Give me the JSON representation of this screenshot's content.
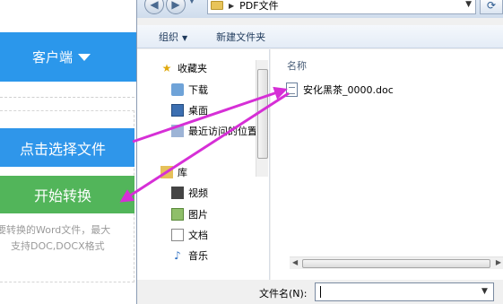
{
  "webpage": {
    "client_label": "客户端",
    "choose_file_button": "点击选择文件",
    "start_convert_button": "开始转换",
    "hint_line1": "要转换的Word文件，最大",
    "hint_line2": "支持DOC,DOCX格式"
  },
  "dialog": {
    "breadcrumb_folder": "PDF文件",
    "toolbar": {
      "organize": "组织",
      "new_folder": "新建文件夹"
    },
    "nav_items": [
      {
        "label": "收藏夹",
        "icon": "star-icon"
      },
      {
        "label": "下载",
        "icon": "download-folder-icon"
      },
      {
        "label": "桌面",
        "icon": "desktop-icon"
      },
      {
        "label": "最近访问的位置",
        "icon": "recent-places-icon"
      },
      {
        "label": "库",
        "icon": "library-icon"
      },
      {
        "label": "视频",
        "icon": "video-icon"
      },
      {
        "label": "图片",
        "icon": "picture-icon"
      },
      {
        "label": "文档",
        "icon": "document-icon"
      },
      {
        "label": "音乐",
        "icon": "music-icon"
      }
    ],
    "column_header": "名称",
    "files": [
      {
        "name": "安化黑茶_0000.doc",
        "icon": "word-doc-icon"
      }
    ],
    "filename_label": "文件名(N):",
    "filename_value": ""
  },
  "colors": {
    "client_bar": "#2b97eb",
    "choose_button": "#2f96ea",
    "convert_button": "#52b55a",
    "annotation_arrow": "#d62fd6"
  }
}
